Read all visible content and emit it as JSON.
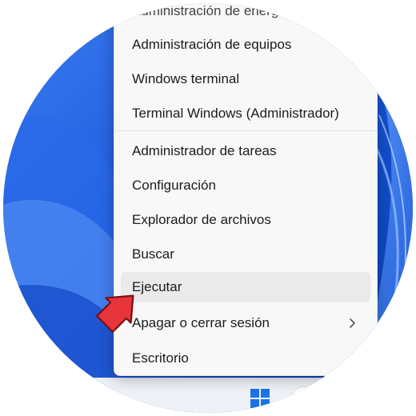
{
  "context_menu": {
    "items": [
      {
        "label": "Administración de energía",
        "partial": true
      },
      {
        "label": "Administración de equipos"
      },
      {
        "label": "Windows terminal"
      },
      {
        "label": "Terminal Windows (Administrador)"
      },
      {
        "label": "Administrador de tareas"
      },
      {
        "label": "Configuración"
      },
      {
        "label": "Explorador de archivos"
      },
      {
        "label": "Buscar"
      },
      {
        "label": "Ejecutar",
        "highlighted": true
      },
      {
        "label": "Apagar o cerrar sesión",
        "has_submenu": true
      },
      {
        "label": "Escritorio"
      }
    ]
  },
  "taskbar": {
    "start_icon": "windows-logo-icon"
  },
  "annotation": {
    "pointer_icon": "red-arrow-pointer-icon",
    "color": "#e8343b"
  },
  "colors": {
    "wallpaper_blue": "#1a5bd8",
    "accent_blue": "#0a63d6"
  }
}
